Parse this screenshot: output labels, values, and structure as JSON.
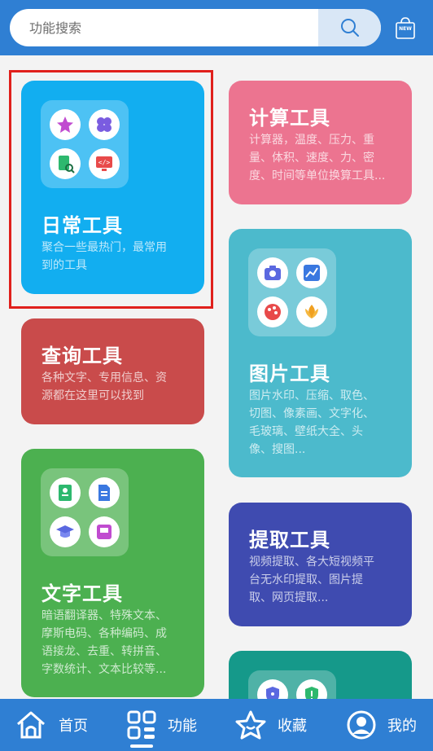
{
  "search": {
    "placeholder": "功能搜索"
  },
  "header": {
    "bag_badge": "NEW"
  },
  "cards": {
    "daily": {
      "title": "日常工具",
      "desc_line1": "聚合一些最热门，最常用",
      "desc_line2": "到的工具",
      "color": "#12aef0"
    },
    "calc": {
      "title": "计算工具",
      "desc_line1": "计算器，温度、压力、重",
      "desc_line2": "量、体积、速度、力、密",
      "desc_line3": "度、时间等单位换算工具...",
      "color": "#ec7490"
    },
    "query": {
      "title": "查询工具",
      "desc_line1": "各种文字、专用信息、资",
      "desc_line2": "源都在这里可以找到",
      "color": "#c94b4b"
    },
    "image": {
      "title": "图片工具",
      "desc_line1": "图片水印、压缩、取色、",
      "desc_line2": "切图、像素画、文字化、",
      "desc_line3": "毛玻璃、壁纸大全、头",
      "desc_line4": "像、搜图...",
      "color": "#4cbacc"
    },
    "text": {
      "title": "文字工具",
      "desc_line1": "暗语翻译器、特殊文本、",
      "desc_line2": "摩斯电码、各种编码、成",
      "desc_line3": "语接龙、去重、转拼音、",
      "desc_line4": "字数统计、文本比较等...",
      "color": "#4cb050"
    },
    "extract": {
      "title": "提取工具",
      "desc_line1": "视频提取、各大短视频平",
      "desc_line2": "台无水印提取、图片提",
      "desc_line3": "取、网页提取...",
      "color": "#3f4bb0"
    },
    "security": {
      "color": "#15998a"
    }
  },
  "nav": {
    "home": "首页",
    "features": "功能",
    "favorites": "收藏",
    "mine": "我的"
  },
  "colors": {
    "brand": "#2f7fd3",
    "highlight": "#e0201c"
  }
}
